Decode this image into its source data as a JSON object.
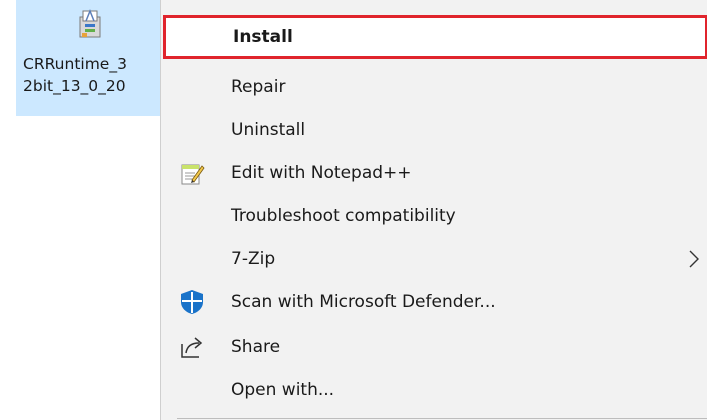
{
  "file": {
    "name_line1": "CRRuntime_3",
    "name_line2": "2bit_13_0_20",
    "icon": "installer-package-icon"
  },
  "menu": {
    "items": [
      {
        "label": "Install",
        "icon": null,
        "highlighted": true
      },
      {
        "label": "Repair",
        "icon": null
      },
      {
        "label": "Uninstall",
        "icon": null
      },
      {
        "label": "Edit with Notepad++",
        "icon": "notepad-plus-plus-icon"
      },
      {
        "label": "Troubleshoot compatibility",
        "icon": null
      },
      {
        "label": "7-Zip",
        "icon": null,
        "submenu": true
      },
      {
        "label": "Scan with Microsoft Defender...",
        "icon": "microsoft-defender-icon"
      },
      {
        "label": "Share",
        "icon": "share-icon"
      },
      {
        "label": "Open with...",
        "icon": null
      }
    ]
  },
  "colors": {
    "selection": "#cce8ff",
    "menu_background": "#f2f2f2",
    "highlight_border": "#e0242c"
  }
}
